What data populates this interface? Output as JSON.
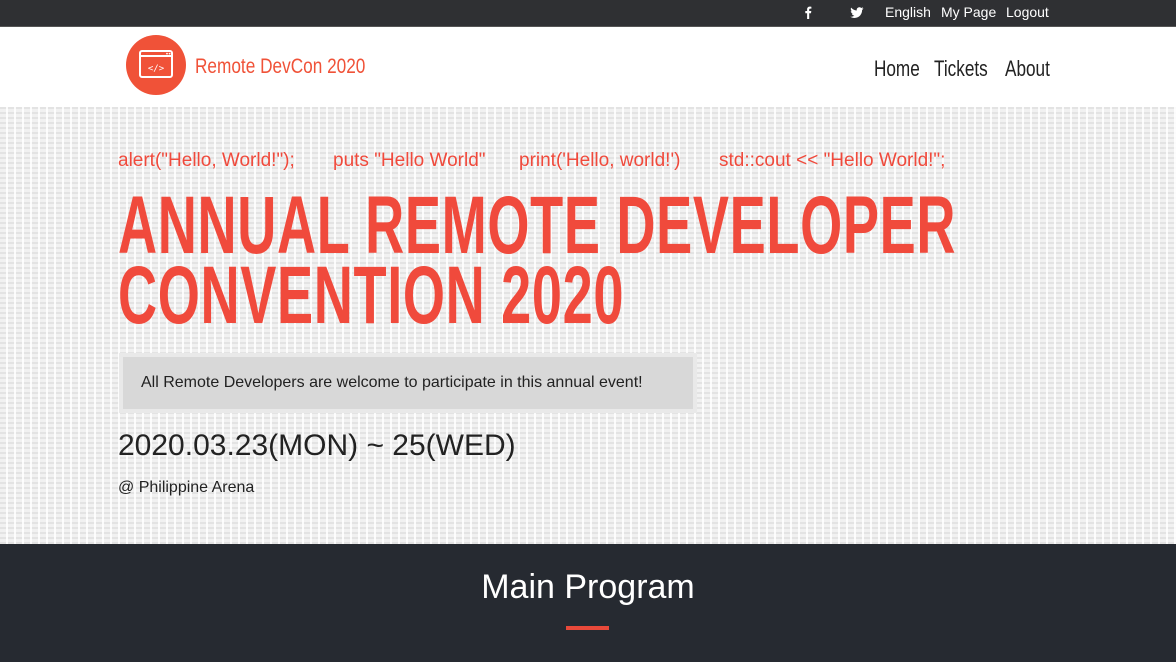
{
  "topbar": {
    "facebook_icon": "facebook-icon",
    "twitter_icon": "twitter-icon",
    "links": [
      "English",
      "My Page",
      "Logout"
    ]
  },
  "header": {
    "logo_glyph": "</>",
    "logo_text": "Remote DevCon 2020",
    "nav": [
      "Home",
      "Tickets",
      "About"
    ]
  },
  "hero": {
    "code_snippets": [
      "alert(\"Hello, World!\");",
      "puts \"Hello World\"",
      "print('Hello, world!')",
      "std::cout << \"Hello World!\";"
    ],
    "title_line1": "ANNUAL REMOTE DEVELOPER",
    "title_line2": "CONVENTION 2020",
    "welcome": "All Remote Developers are welcome to participate in this annual event!",
    "date": "2020.03.23(MON) ~ 25(WED)",
    "venue": "@ Philippine Arena"
  },
  "program": {
    "title": "Main Program"
  },
  "colors": {
    "accent": "#f04a3c",
    "topbar": "#2f3033",
    "program_bg": "#262a31"
  }
}
